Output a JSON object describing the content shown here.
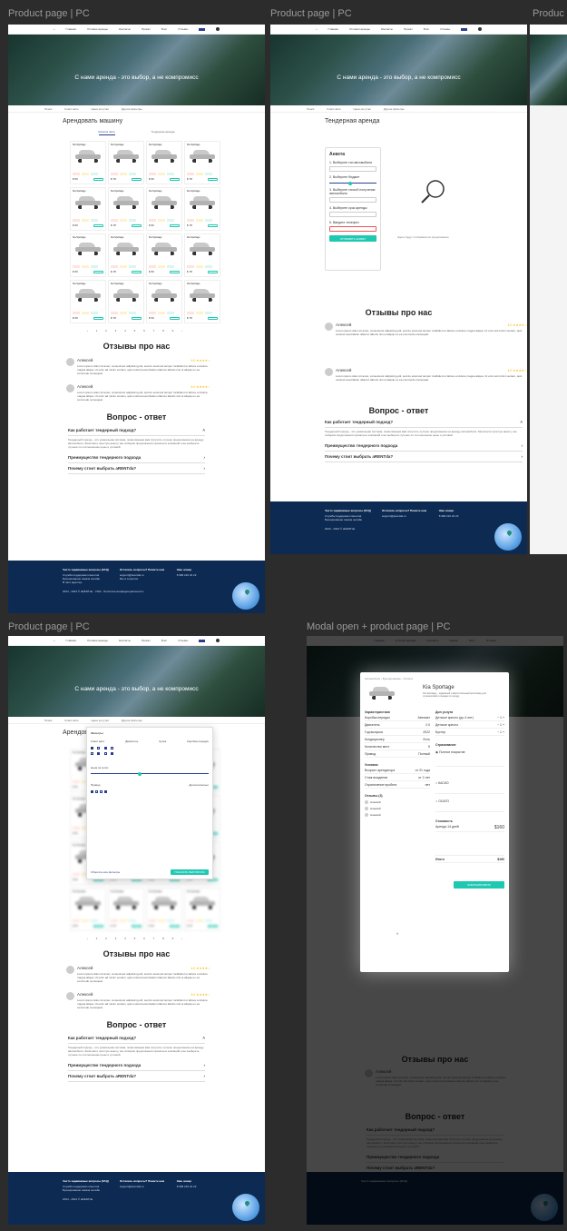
{
  "frames": {
    "f1_title": "Product page | PC",
    "f2_title": "Product page | PC",
    "f3_title": "Product page | PC",
    "f4_title": "Modal open + product page | PC",
    "f5_title": "Produc"
  },
  "nav": {
    "items": [
      "Главная",
      "Условия аренды",
      "Контакты",
      "Прокат",
      "Блог",
      "Отзывы"
    ]
  },
  "hero": {
    "slogan": "С нами аренда - это выбор, а не компромисс"
  },
  "filter": {
    "items": [
      "Поиск",
      "Класс авто",
      "Цена за сутки",
      "Другие фильтры"
    ]
  },
  "catalog": {
    "title": "Арендовать машину",
    "tab_active": "Каталог авто",
    "tab_other": "Тендерная аренда",
    "card_name": "Kia Sportage",
    "price_1": "$ 56",
    "price_2": "$ 78",
    "pager": "‹ 1 2 3 4 5 6 7 8 9 ›"
  },
  "tender": {
    "title": "Тендерная аренда",
    "form_title": "Анкета",
    "step1": "1. Выберите тип автомобиля",
    "step2": "2. Выберите бюджет",
    "step3": "3. Выберите способ получения автомобиля",
    "step4": "4. Выберите срок аренды",
    "step5": "5. Введите телефон",
    "submit": "ОТПРАВИТЬ ЗАЯВКУ",
    "empty": "Здесь будут отображаться предложения"
  },
  "reviews": {
    "title": "Отзывы про нас",
    "name": "Алексей",
    "stars": "4.0 ★★★★☆",
    "text": "Lorem ipsum dolor sit amet, consectetur adipiscing elit, sed do eiusmod tempor incididunt ut labore et dolore magna aliqua. Ut enim ad minim veniam, quis nostrud exercitation ullamco laboris nisi ut aliquip ex ea commodo consequat.",
    "reply": "Ответить"
  },
  "faq": {
    "title": "Вопрос - ответ",
    "q1": "Как работает тендерный подход?",
    "a1": "Тендерный подход – это уникальная система, позволяющая вам получить лучшее предложение на аренду автомобиля. Заполните простую анкету, мы соберём предложения прокатных компаний и вы выберете лучшее по соотношению цены и условий.",
    "q2": "Преимущество тендерного подхода",
    "q3": "Почему стоит выбрать aRENTda?"
  },
  "footer": {
    "col1_title": "Часто задаваемые вопросы (FAQ)",
    "col1_items": [
      "Служба поддержки клиентов",
      "Бронирование заказа онлайн",
      "В чате адаптер",
      "Дополнительные услуги"
    ],
    "col2_title": "Остались вопросы? Пишите нам",
    "col2_items": [
      "support@arentda.ru",
      "Мы в соцсетях"
    ],
    "col3_title": "Наш номер",
    "col3_items": [
      "8 999 222 22 22"
    ],
    "copyright": "2024 - 2024 © aRENTda",
    "pay": [
      "MC",
      "VISA"
    ],
    "links": [
      "Политика конфиденциальности",
      "Пользовательское соглашение",
      "Карта сайта"
    ]
  },
  "filters_panel": {
    "title": "Фильтры",
    "groups": [
      "Класс авто",
      "Двигатель",
      "Кузов",
      "Коробка передач",
      "Цена за сутки",
      "Привод",
      "Дополнительно"
    ],
    "reset": "Сбросить все фильтры",
    "apply": "ПОКАЗАТЬ РЕЗУЛЬТАТЫ"
  },
  "modal": {
    "breadcrumb": "Автомобили › Бронирование › Оплата",
    "car": "Kia Sportage",
    "desc": "Kia Sportage – надёжный и вместительный кроссовер для путешествий и поездок по городу.",
    "specs_title": "Характеристики",
    "specs": [
      [
        "Коробка передач",
        "Автомат"
      ],
      [
        "Двигатель",
        "2.0"
      ],
      [
        "Год выпуска",
        "2022"
      ],
      [
        "Кондиционер",
        "Есть"
      ],
      [
        "Количество мест",
        "5"
      ],
      [
        "Привод",
        "Полный"
      ]
    ],
    "terms_title": "Условия",
    "terms": [
      [
        "Возраст арендатора",
        "от 21 года"
      ],
      [
        "Стаж вождения",
        "от 2 лет"
      ],
      [
        "Ограничение пробега",
        "нет"
      ]
    ],
    "reviews_title": "Отзывы (3)",
    "services_title": "Доп услуги",
    "services": [
      "Детское кресло (до 4 лет)",
      "Детское кресло",
      "Бустер"
    ],
    "insurance_title": "Страхование",
    "insurance": [
      "Полное покрытие",
      "КАСКО",
      "ОСАГО"
    ],
    "cost_title": "Стоимость",
    "cost_rows": [
      [
        "Аренда 14 дней",
        "$160"
      ],
      [
        "Итого",
        "$160"
      ]
    ],
    "book": "ЗАБРОНИРОВАТЬ"
  }
}
